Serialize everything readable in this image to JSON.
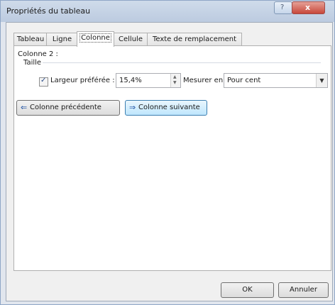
{
  "window": {
    "title": "Propriétés du tableau",
    "help_glyph": "?",
    "close_glyph": "x"
  },
  "tabs": [
    {
      "label": "Tableau"
    },
    {
      "label": "Ligne"
    },
    {
      "label": "Colonne"
    },
    {
      "label": "Cellule"
    },
    {
      "label": "Texte de remplacement"
    }
  ],
  "column": {
    "header": "Colonne 2 :",
    "section": "Taille"
  },
  "preferred_width": {
    "checked": true,
    "label": "Largeur préférée :",
    "value": "15,4%"
  },
  "measure": {
    "label": "Mesurer en :",
    "value": "Pour cent"
  },
  "nav": {
    "prev_label": "Colonne précédente",
    "next_label": "Colonne suivante"
  },
  "footer": {
    "ok_label": "OK",
    "cancel_label": "Annuler"
  },
  "colors": {
    "title_bar": "#c6d4e7",
    "close_button": "#c7473a",
    "hover_button": "#bee6fd"
  }
}
